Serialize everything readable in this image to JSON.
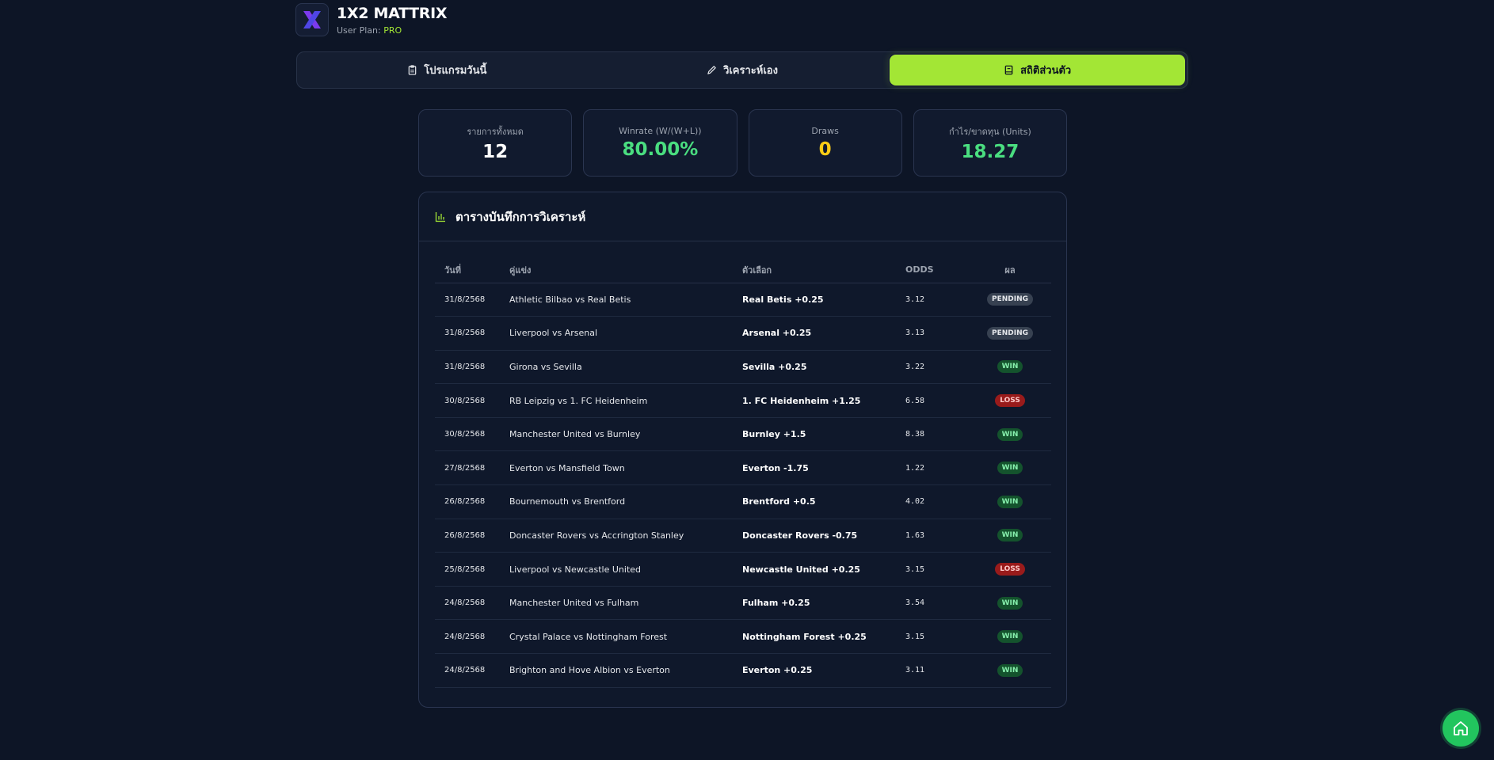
{
  "app": {
    "title": "1X2 MATTRIX",
    "plan_label": "User Plan:",
    "plan_value": "PRO"
  },
  "tabs": [
    {
      "label": "โปรแกรมวันนี้",
      "icon": "clipboard-icon"
    },
    {
      "label": "วิเคราะห์เอง",
      "icon": "pencil-icon"
    },
    {
      "label": "สถิติส่วนตัว",
      "icon": "book-icon",
      "active": true
    }
  ],
  "stats": [
    {
      "label": "รายการทั้งหมด",
      "value": "12",
      "color": "#ffffff"
    },
    {
      "label": "Winrate (W/(W+L))",
      "value": "80.00%",
      "color": "#4ade80"
    },
    {
      "label": "Draws",
      "value": "0",
      "color": "#facc15"
    },
    {
      "label": "กำไร/ขาดทุน (Units)",
      "value": "18.27",
      "color": "#4ade80"
    }
  ],
  "panel": {
    "title": "ตารางบันทึกการวิเคราะห์",
    "icon": "bar-chart-icon"
  },
  "table": {
    "headers": [
      "วันที่",
      "คู่แข่ง",
      "ตัวเลือก",
      "ODDS",
      "ผล"
    ],
    "rows": [
      {
        "date": "31/8/2568",
        "match": "Athletic Bilbao vs Real Betis",
        "pick": "Real Betis +0.25",
        "odds": "3.12",
        "result": "PENDING"
      },
      {
        "date": "31/8/2568",
        "match": "Liverpool vs Arsenal",
        "pick": "Arsenal +0.25",
        "odds": "3.13",
        "result": "PENDING"
      },
      {
        "date": "31/8/2568",
        "match": "Girona vs Sevilla",
        "pick": "Sevilla +0.25",
        "odds": "3.22",
        "result": "WIN"
      },
      {
        "date": "30/8/2568",
        "match": "RB Leipzig vs 1. FC Heidenheim",
        "pick": "1. FC Heidenheim +1.25",
        "odds": "6.58",
        "result": "LOSS"
      },
      {
        "date": "30/8/2568",
        "match": "Manchester United vs Burnley",
        "pick": "Burnley +1.5",
        "odds": "8.38",
        "result": "WIN"
      },
      {
        "date": "27/8/2568",
        "match": "Everton vs Mansfield Town",
        "pick": "Everton -1.75",
        "odds": "1.22",
        "result": "WIN"
      },
      {
        "date": "26/8/2568",
        "match": "Bournemouth vs Brentford",
        "pick": "Brentford +0.5",
        "odds": "4.02",
        "result": "WIN"
      },
      {
        "date": "26/8/2568",
        "match": "Doncaster Rovers vs Accrington Stanley",
        "pick": "Doncaster Rovers -0.75",
        "odds": "1.63",
        "result": "WIN"
      },
      {
        "date": "25/8/2568",
        "match": "Liverpool vs Newcastle United",
        "pick": "Newcastle United +0.25",
        "odds": "3.15",
        "result": "LOSS"
      },
      {
        "date": "24/8/2568",
        "match": "Manchester United vs Fulham",
        "pick": "Fulham +0.25",
        "odds": "3.54",
        "result": "WIN"
      },
      {
        "date": "24/8/2568",
        "match": "Crystal Palace vs Nottingham Forest",
        "pick": "Nottingham Forest +0.25",
        "odds": "3.15",
        "result": "WIN"
      },
      {
        "date": "24/8/2568",
        "match": "Brighton and Hove Albion vs Everton",
        "pick": "Everton +0.25",
        "odds": "3.11",
        "result": "WIN"
      }
    ]
  },
  "colors": {
    "accent": "#a3e635",
    "background": "#0d1526",
    "win": "#86efac",
    "loss": "#991b1b",
    "pending": "#374151",
    "fab": "#22c55e"
  },
  "fab": {
    "icon": "home-icon"
  }
}
